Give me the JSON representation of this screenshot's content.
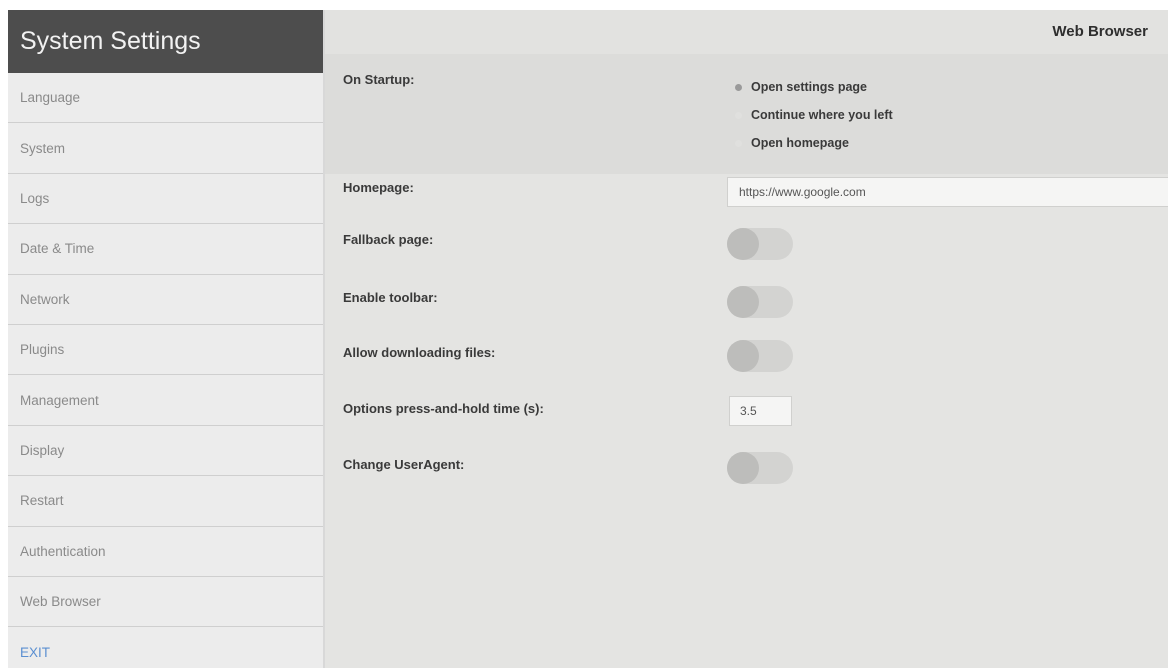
{
  "sidebar": {
    "title": "System Settings",
    "items": [
      {
        "label": "Language"
      },
      {
        "label": "System"
      },
      {
        "label": "Logs"
      },
      {
        "label": "Date & Time"
      },
      {
        "label": "Network"
      },
      {
        "label": "Plugins"
      },
      {
        "label": "Management"
      },
      {
        "label": "Display"
      },
      {
        "label": "Restart"
      },
      {
        "label": "Authentication"
      },
      {
        "label": "Web Browser"
      }
    ],
    "exit_label": "EXIT"
  },
  "header": {
    "title": "Web Browser"
  },
  "settings": {
    "on_startup": {
      "label": "On Startup:",
      "options": [
        {
          "label": "Open settings page",
          "selected": true
        },
        {
          "label": "Continue where you left",
          "selected": false
        },
        {
          "label": "Open homepage",
          "selected": false
        }
      ]
    },
    "homepage": {
      "label": "Homepage:",
      "value": "https://www.google.com"
    },
    "fallback_page": {
      "label": "Fallback page:",
      "enabled": false
    },
    "enable_toolbar": {
      "label": "Enable toolbar:",
      "enabled": false
    },
    "allow_downloading": {
      "label": "Allow downloading files:",
      "enabled": false
    },
    "press_hold_time": {
      "label": "Options press-and-hold time (s):",
      "value": "3.5"
    },
    "change_useragent": {
      "label": "Change UserAgent:",
      "enabled": false
    }
  },
  "colors": {
    "sidebar_header_bg": "#4d4d4d",
    "sidebar_bg": "#ececec",
    "main_bg": "#e4e4e2",
    "exit_link": "#5b8fd1",
    "toggle_off": "#d3d3d1"
  }
}
